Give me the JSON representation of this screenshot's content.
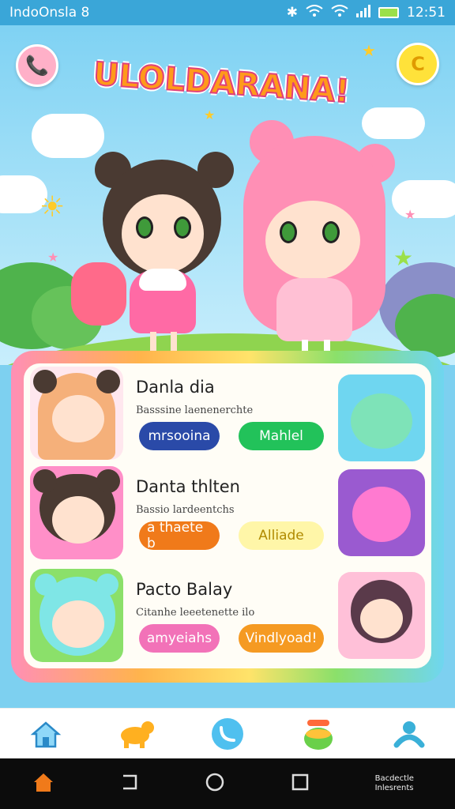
{
  "status_bar": {
    "carrier": "IndoOnsla  8",
    "time": "12:51"
  },
  "hero": {
    "title": "ULOLDARANA!",
    "left_button_icon": "phone-icon",
    "right_button_icon": "refresh-icon"
  },
  "list": [
    {
      "name": "Danla dia",
      "subtitle": "Basssine laenenerchte",
      "left_pill": "mrsooina",
      "right_pill": "Mahlel",
      "left_pill_color": "#2a4aa8",
      "right_pill_color": "#22c25a"
    },
    {
      "name": "Danta thlten",
      "subtitle": "Bassio lardeentchs",
      "left_pill": "a thaete b",
      "right_pill": "Alliade",
      "left_pill_color": "#f07a1a",
      "right_pill_color": "#fff6a8"
    },
    {
      "name": "Pacto Balay",
      "subtitle": "Citanhe leeetenette ilo",
      "left_pill": "amyeiahs",
      "right_pill": "Vindlyoad!",
      "left_pill_color": "#f272b8",
      "right_pill_color": "#f59a22"
    }
  ],
  "bottom_nav": [
    {
      "icon": "home-icon"
    },
    {
      "icon": "pet-icon"
    },
    {
      "icon": "phone-icon"
    },
    {
      "icon": "jar-icon"
    },
    {
      "icon": "people-icon"
    }
  ],
  "system_nav": {
    "text_line1": "Bacdectle",
    "text_line2": "Inlesrents"
  },
  "colors": {
    "sky": "#7dd0f0",
    "status_bar": "#3aa6d8",
    "title_fill": "#ff9a1a",
    "title_outline": "#e0407a"
  }
}
